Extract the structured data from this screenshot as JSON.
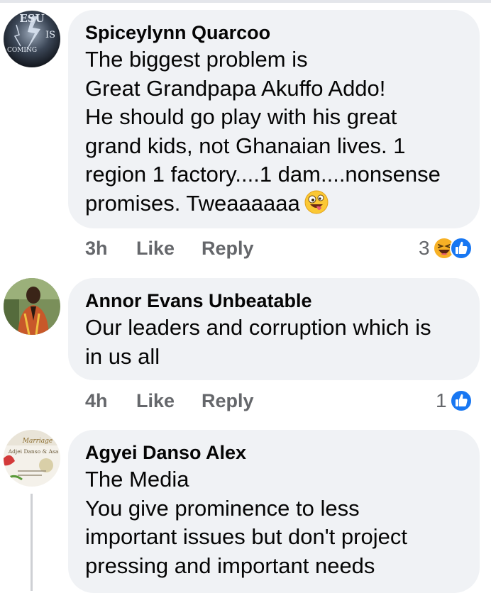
{
  "comments": [
    {
      "author": "Spiceylynn Quarcoo",
      "text": "The biggest problem is\nGreat Grandpapa Akuffo Addo!\nHe should go play with his great\ngrand kids, not Ghanaian lives. 1\nregion 1 factory....1 dam....nonsense\npromises. Tweaaaaaa",
      "emoji": "zany-face-emoji",
      "avatar_text_top": "ESU",
      "avatar_text_side": "IS",
      "avatar_text_mid": "COMING",
      "time": "3h",
      "like": "Like",
      "reply": "Reply",
      "reaction_count": "3",
      "reaction_icons": [
        "haha-icon",
        "like-icon"
      ]
    },
    {
      "author": "Annor Evans Unbeatable",
      "text": "Our leaders and corruption which is\nin us all",
      "time": "4h",
      "like": "Like",
      "reply": "Reply",
      "reaction_count": "1",
      "reaction_icons": [
        "like-icon"
      ]
    },
    {
      "author": "Agyei Danso Alex",
      "text": "The Media\nYou give prominence to less\nimportant issues but don't project\npressing and important needs",
      "avatar_text_a": "Marriage",
      "avatar_text_b": "Adjei Danso & Asa"
    }
  ],
  "colors": {
    "bubble": "#f0f2f5",
    "author": "#050505",
    "meta": "#65676b",
    "like_blue": "#1877f2",
    "haha_yellow": "#f7b125"
  }
}
